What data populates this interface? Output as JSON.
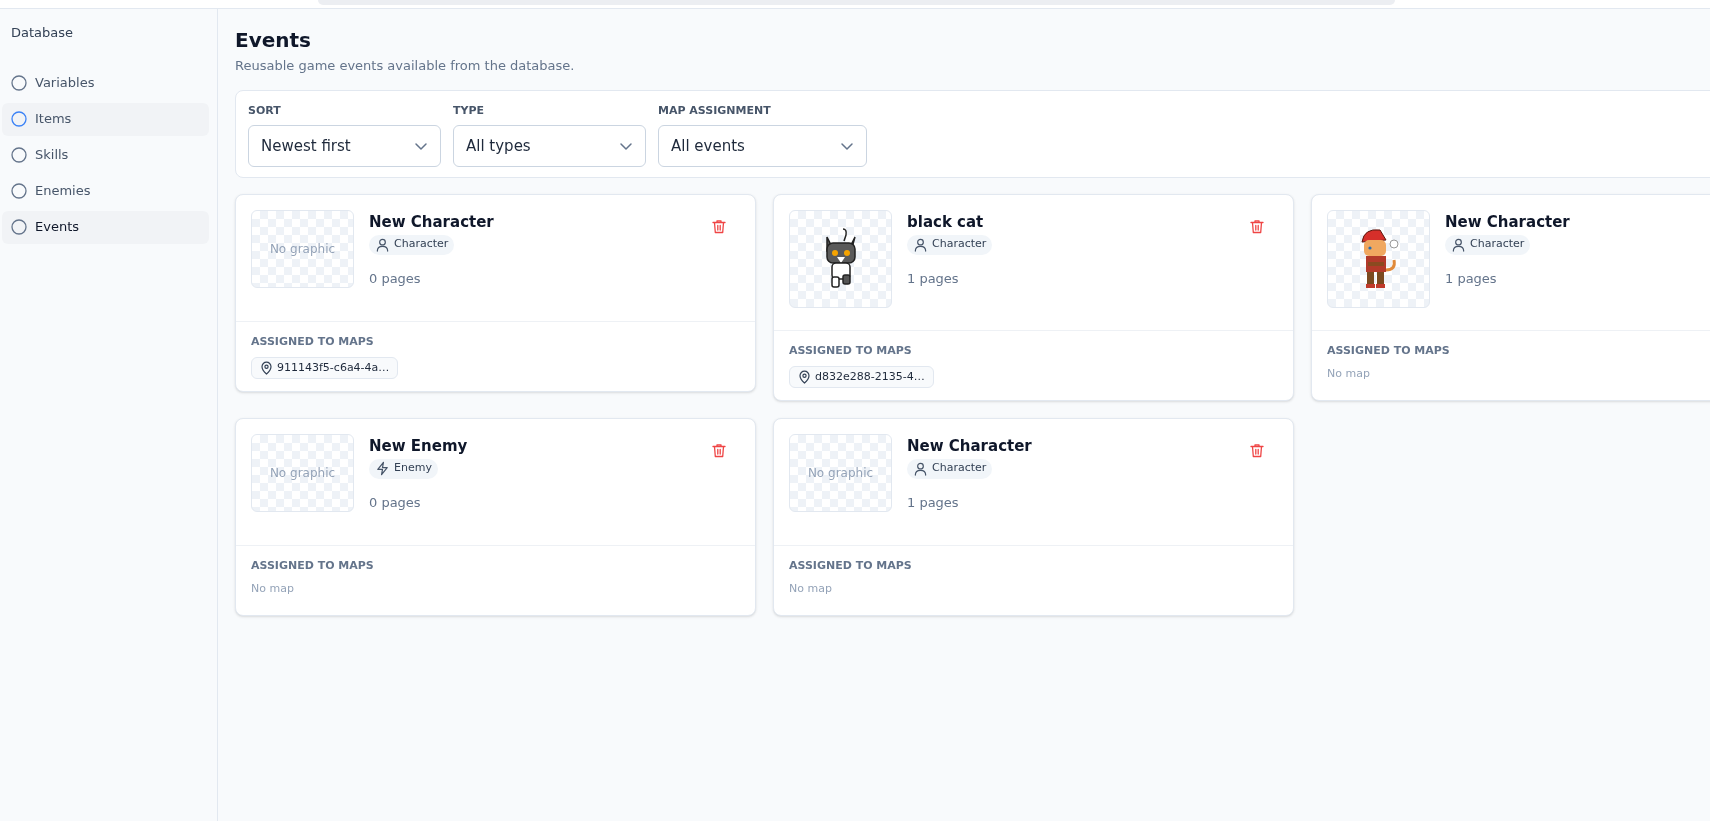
{
  "sidebar": {
    "title": "Database",
    "items": [
      {
        "label": "Variables",
        "selected": false,
        "highlighted": false
      },
      {
        "label": "Items",
        "selected": false,
        "highlighted": true
      },
      {
        "label": "Skills",
        "selected": false,
        "highlighted": false
      },
      {
        "label": "Enemies",
        "selected": false,
        "highlighted": false
      },
      {
        "label": "Events",
        "selected": true,
        "highlighted": false
      }
    ]
  },
  "page": {
    "title": "Events",
    "subtitle": "Reusable game events available from the database."
  },
  "filters": [
    {
      "label": "SORT",
      "value": "Newest first"
    },
    {
      "label": "TYPE",
      "value": "All types"
    },
    {
      "label": "MAP ASSIGNMENT",
      "value": "All events"
    }
  ],
  "events": [
    {
      "name": "New Character",
      "type": {
        "kind": "character",
        "label": "Character"
      },
      "graphic": {
        "kind": "none",
        "text": "No graphic"
      },
      "pages": "0 pages",
      "maps_label": "ASSIGNED TO MAPS",
      "maps": [
        "911143f5-c6a4-4a…"
      ]
    },
    {
      "name": "black cat",
      "type": {
        "kind": "character",
        "label": "Character"
      },
      "graphic": {
        "kind": "cat"
      },
      "pages": "1 pages",
      "maps_label": "ASSIGNED TO MAPS",
      "maps": [
        "d832e288-2135-4…"
      ]
    },
    {
      "name": "New Character",
      "type": {
        "kind": "character",
        "label": "Character"
      },
      "graphic": {
        "kind": "hero"
      },
      "pages": "1 pages",
      "maps_label": "ASSIGNED TO MAPS",
      "no_map": "No map"
    },
    {
      "name": "New Enemy",
      "type": {
        "kind": "enemy",
        "label": "Enemy"
      },
      "graphic": {
        "kind": "none",
        "text": "No graphic"
      },
      "pages": "0 pages",
      "maps_label": "ASSIGNED TO MAPS",
      "no_map": "No map"
    },
    {
      "name": "New Character",
      "type": {
        "kind": "character",
        "label": "Character"
      },
      "graphic": {
        "kind": "none",
        "text": "No graphic"
      },
      "pages": "1 pages",
      "maps_label": "ASSIGNED TO MAPS",
      "no_map": "No map"
    }
  ]
}
